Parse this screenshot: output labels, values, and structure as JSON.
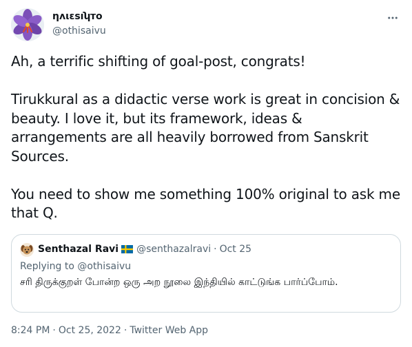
{
  "author": {
    "display_name": "ηʌιɛsıʮто",
    "handle": "@othisaivu"
  },
  "tweet": {
    "paragraphs": [
      "Ah, a terrific shifting of goal-post, congrats!",
      "Tirukkural as a didactic verse work is great in concision & beauty. I love it, but its framework, ideas & arrangements are all heavily borrowed from Sanskrit Sources.",
      "You need to show me something 100% original to ask me that Q."
    ]
  },
  "quoted": {
    "name": "Senthazal Ravi",
    "handle": "@senthazalravi",
    "separator": "·",
    "date": "Oct 25",
    "replying_to": "Replying to @othisaivu",
    "text": "சரி திருக்குறள் போன்ற ஒரு அற நூலை இந்தியில் காட்டுங்க பார்ப்போம்."
  },
  "meta": {
    "time": "8:24 PM",
    "separator": "·",
    "date": "Oct 25, 2022",
    "source": "Twitter Web App"
  },
  "icons": {
    "more": "more-horizontal-icon",
    "flag": "sweden-flag-icon"
  },
  "colors": {
    "text": "#0f1419",
    "secondary": "#536471",
    "border": "#cfd9de",
    "flag_blue": "#006aa7",
    "flag_yellow": "#fecc00"
  }
}
